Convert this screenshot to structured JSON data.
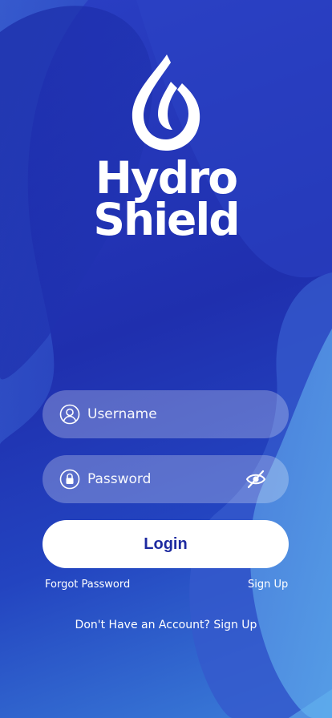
{
  "brand": {
    "line1": "Hydro",
    "line2": "Shield"
  },
  "form": {
    "username_placeholder": "Username",
    "password_placeholder": "Password",
    "login_label": "Login",
    "forgot_label": "Forgot Password",
    "signup_label": "Sign Up",
    "bottom_text": "Don't Have an Account? Sign Up"
  },
  "colors": {
    "background": "#2438b8",
    "button_text": "#1d2aa0",
    "button_bg": "#ffffff"
  },
  "icons": {
    "logo": "water-drop-icon",
    "username": "user-icon",
    "password": "lock-icon",
    "toggle": "eye-off-icon"
  }
}
